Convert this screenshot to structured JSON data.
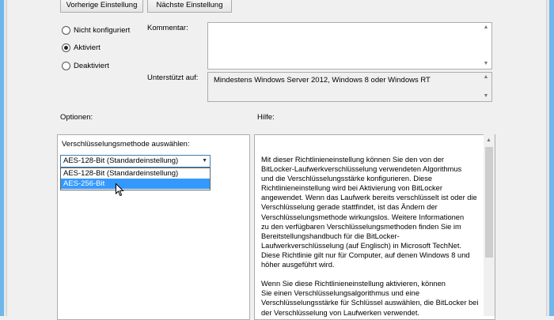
{
  "nav": {
    "prev_label": "Vorherige Einstellung",
    "next_label": "Nächste Einstellung"
  },
  "state": {
    "options": [
      "Nicht konfiguriert",
      "Aktiviert",
      "Deaktiviert"
    ],
    "selected": "Aktiviert"
  },
  "comment": {
    "label": "Kommentar:",
    "value": ""
  },
  "supported": {
    "label": "Unterstützt auf:",
    "value": "Mindestens Windows Server 2012, Windows 8 oder Windows RT"
  },
  "options_section": {
    "label": "Optionen:",
    "method_label": "Verschlüsselungsmethode auswählen:",
    "selected_value": "AES-128-Bit (Standardeinstellung)",
    "dropdown_items": [
      "AES-128-Bit (Standardeinstellung)",
      "AES-256-Bit"
    ],
    "highlighted_item": "AES-256-Bit"
  },
  "help_section": {
    "label": "Hilfe:",
    "text": "        Mit dieser Richtlinieneinstellung können Sie den von der\nBitLocker-Laufwerkverschlüsselung verwendeten Algorithmus\nund die Verschlüsselungsstärke konfigurieren. Diese\nRichtlinieneinstellung wird bei Aktivierung von BitLocker\nangewendet. Wenn das Laufwerk bereits verschlüsselt ist oder die\nVerschlüsselung gerade stattfindet, ist das Ändern der\nVerschlüsselungsmethode wirkungslos. Weitere Informationen\nzu den verfügbaren Verschlüsselungsmethoden finden Sie im\nBereitstellungshandbuch für die BitLocker-\nLaufwerkverschlüsselung (auf Englisch) in Microsoft TechNet.\nDiese Richtlinie gilt nur für Computer, auf denen Windows 8 und\nhöher ausgeführt wird.\n\n        Wenn Sie diese Richtlinieneinstellung aktivieren, können\nSie einen Verschlüsselungsalgorithmus und eine\nVerschlüsselungsstärke für Schlüssel auswählen, die BitLocker bei\nder Verschlüsselung von Laufwerken verwendet."
  }
}
